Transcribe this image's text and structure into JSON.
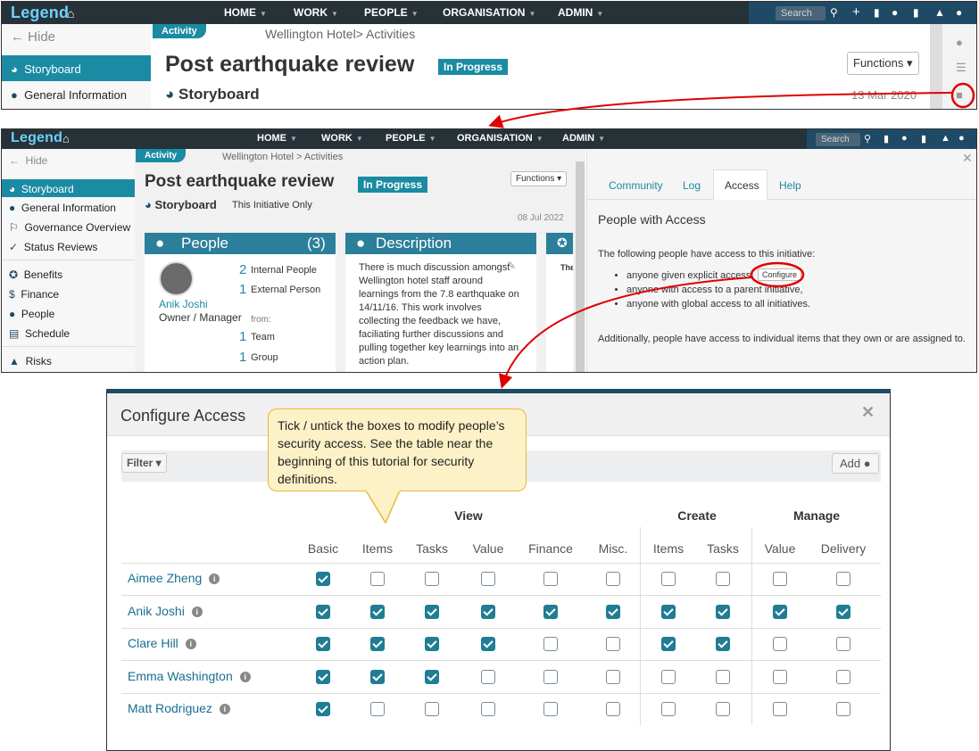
{
  "app": {
    "logo": "Legend"
  },
  "nav": {
    "items": [
      "HOME",
      "WORK",
      "PEOPLE",
      "ORGANISATION",
      "ADMIN"
    ],
    "search_placeholder": "Search"
  },
  "sidebar": {
    "hide": "Hide",
    "items": [
      "Storyboard",
      "General Information",
      "Governance Overview",
      "Status Reviews",
      "Benefits",
      "Finance",
      "People",
      "Schedule",
      "Risks"
    ]
  },
  "page": {
    "tag": "Activity",
    "breadcrumb": "Wellington Hotel> Activities",
    "breadcrumb2": "Wellington Hotel > Activities",
    "title": "Post earthquake review",
    "status": "In Progress",
    "functions": "Functions",
    "section": "Storyboard",
    "scope": "This Initiative Only",
    "date1": "13 Mar 2020",
    "date2": "08 Jul 2022"
  },
  "people_card": {
    "title": "People",
    "count": "(3)",
    "person_name": "Anik Joshi",
    "person_role": "Owner / Manager",
    "internal_count": "2",
    "internal_label": "Internal People",
    "external_count": "1",
    "external_label": "External Person",
    "from_label": "from:",
    "team_count": "1",
    "team_label": "Team",
    "group_count": "1",
    "group_label": "Group"
  },
  "description_card": {
    "title": "Description",
    "text": "There is much discussion amongst Wellington hotel staff around learnings from the 7.8 earthquake on 14/11/16.  This work involves collecting the feedback we have, faciliating further discussions and pulling together key learnings into an action plan."
  },
  "third_card": {
    "peek": "The"
  },
  "access_panel": {
    "tabs": [
      "Community",
      "Log",
      "Access",
      "Help"
    ],
    "active_tab": "Access",
    "heading": "People with Access",
    "intro": "The following people have access to this initiative:",
    "bullets": [
      "anyone given explicit access",
      "anyone with access to a parent initiative,",
      "anyone with global access to all initiatives."
    ],
    "configure": "Configure",
    "footer": "Additionally, people have access to individual items that they own or are assigned to."
  },
  "configure_access": {
    "title": "Configure Access",
    "filter": "Filter",
    "add": "Add",
    "groups": [
      "View",
      "Create",
      "Manage"
    ],
    "columns": [
      "Basic",
      "Items",
      "Tasks",
      "Value",
      "Finance",
      "Misc.",
      "Items",
      "Tasks",
      "Value",
      "Delivery"
    ],
    "rows": [
      {
        "name": "Aimee Zheng",
        "checks": [
          1,
          0,
          0,
          0,
          0,
          0,
          0,
          0,
          0,
          0
        ]
      },
      {
        "name": "Anik Joshi",
        "checks": [
          1,
          1,
          1,
          1,
          1,
          1,
          1,
          1,
          1,
          1
        ]
      },
      {
        "name": "Clare Hill",
        "checks": [
          1,
          1,
          1,
          1,
          0,
          0,
          1,
          1,
          0,
          0
        ]
      },
      {
        "name": "Emma Washington",
        "checks": [
          1,
          1,
          1,
          0,
          0,
          0,
          0,
          0,
          0,
          0
        ]
      },
      {
        "name": "Matt Rodriguez",
        "checks": [
          1,
          0,
          0,
          0,
          0,
          0,
          0,
          0,
          0,
          0
        ]
      }
    ]
  },
  "callout": {
    "text": "Tick / untick the boxes to modify people’s security access.  See the table near the beginning of this tutorial for security definitions."
  },
  "colors": {
    "teal": "#1a8ba2",
    "navbar": "#263238",
    "annotation": "#e00000",
    "callout_bg": "#fdf1c7"
  }
}
